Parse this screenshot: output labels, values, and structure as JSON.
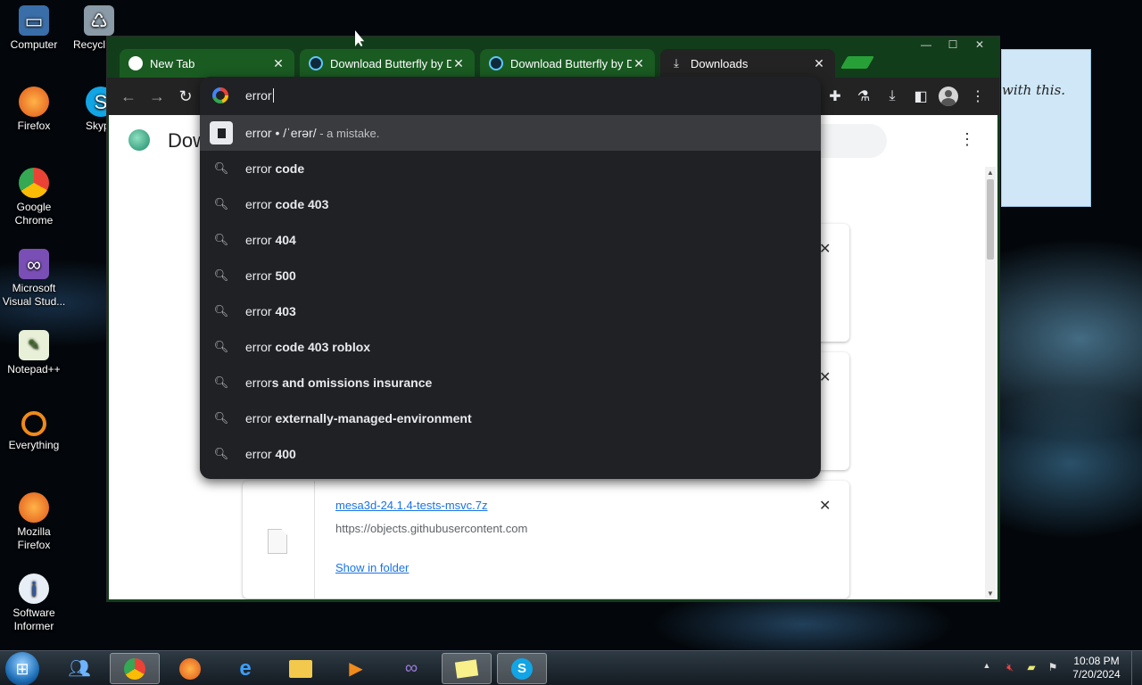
{
  "desktop": {
    "icons": [
      {
        "label": "Computer",
        "icon": "computer-icon"
      },
      {
        "label": "Recycl",
        "icon": "recycle-bin-icon"
      },
      {
        "label": "Firefox",
        "icon": "firefox-icon"
      },
      {
        "label": "Skyp",
        "icon": "skype-icon"
      },
      {
        "label": "Google Chrome",
        "icon": "chrome-icon"
      },
      {
        "label": "Microsoft Visual Stud...",
        "icon": "visual-studio-icon"
      },
      {
        "label": "Notepad++",
        "icon": "notepad-plus-plus-icon"
      },
      {
        "label": "Everything",
        "icon": "everything-search-icon"
      },
      {
        "label": "Mozilla Firefox",
        "icon": "firefox-icon"
      },
      {
        "label": "Software Informer",
        "icon": "software-informer-icon"
      }
    ],
    "sticky_note": {
      "text": "with this."
    }
  },
  "browser": {
    "tabs": [
      {
        "title": "New Tab",
        "icon": "chat-bubble-icon"
      },
      {
        "title": "Download Butterfly by D",
        "icon": "butterfly-icon"
      },
      {
        "title": "Download Butterfly by D",
        "icon": "butterfly-icon"
      },
      {
        "title": "Downloads",
        "icon": "download-icon"
      }
    ],
    "active_tab_index": 3,
    "omnibox": {
      "text": "error",
      "suggestions": [
        {
          "type": "dictionary",
          "prefix": "error",
          "bold": "",
          "extra": " • /ˈerər/",
          "dim": " - a mistake."
        },
        {
          "type": "search",
          "prefix": "error",
          "bold": " code"
        },
        {
          "type": "search",
          "prefix": "error",
          "bold": " code 403"
        },
        {
          "type": "search",
          "prefix": "error",
          "bold": " 404"
        },
        {
          "type": "search",
          "prefix": "error",
          "bold": " 500"
        },
        {
          "type": "search",
          "prefix": "error",
          "bold": " 403"
        },
        {
          "type": "search",
          "prefix": "error",
          "bold": " code 403 roblox"
        },
        {
          "type": "search",
          "prefix": "error",
          "bold": "s and omissions insurance"
        },
        {
          "type": "search",
          "prefix": "error",
          "bold": " externally-managed-environment"
        },
        {
          "type": "search",
          "prefix": "error",
          "bold": " 400"
        }
      ]
    },
    "page": {
      "title": "Dow",
      "downloads": [
        {
          "name": "",
          "url": "",
          "action": ""
        },
        {
          "name": "",
          "url": "",
          "action": ""
        },
        {
          "name": "mesa3d-24.1.4-tests-msvc.7z",
          "url": "https://objects.githubusercontent.com",
          "action": "Show in folder"
        }
      ]
    }
  },
  "taskbar": {
    "items": [
      {
        "name": "windows-live-messenger",
        "icon": "messenger-icon"
      },
      {
        "name": "google-chrome",
        "icon": "chrome-icon",
        "active": true
      },
      {
        "name": "firefox",
        "icon": "firefox-icon"
      },
      {
        "name": "internet-explorer",
        "icon": "internet-explorer-icon"
      },
      {
        "name": "file-explorer",
        "icon": "folder-icon"
      },
      {
        "name": "media-player",
        "icon": "media-player-icon"
      },
      {
        "name": "visual-studio",
        "icon": "visual-studio-icon"
      },
      {
        "name": "sticky-notes",
        "icon": "sticky-notes-icon",
        "active": true
      },
      {
        "name": "skype",
        "icon": "skype-icon",
        "active": true
      }
    ],
    "clock": {
      "time": "10:08 PM",
      "date": "7/20/2024"
    }
  }
}
